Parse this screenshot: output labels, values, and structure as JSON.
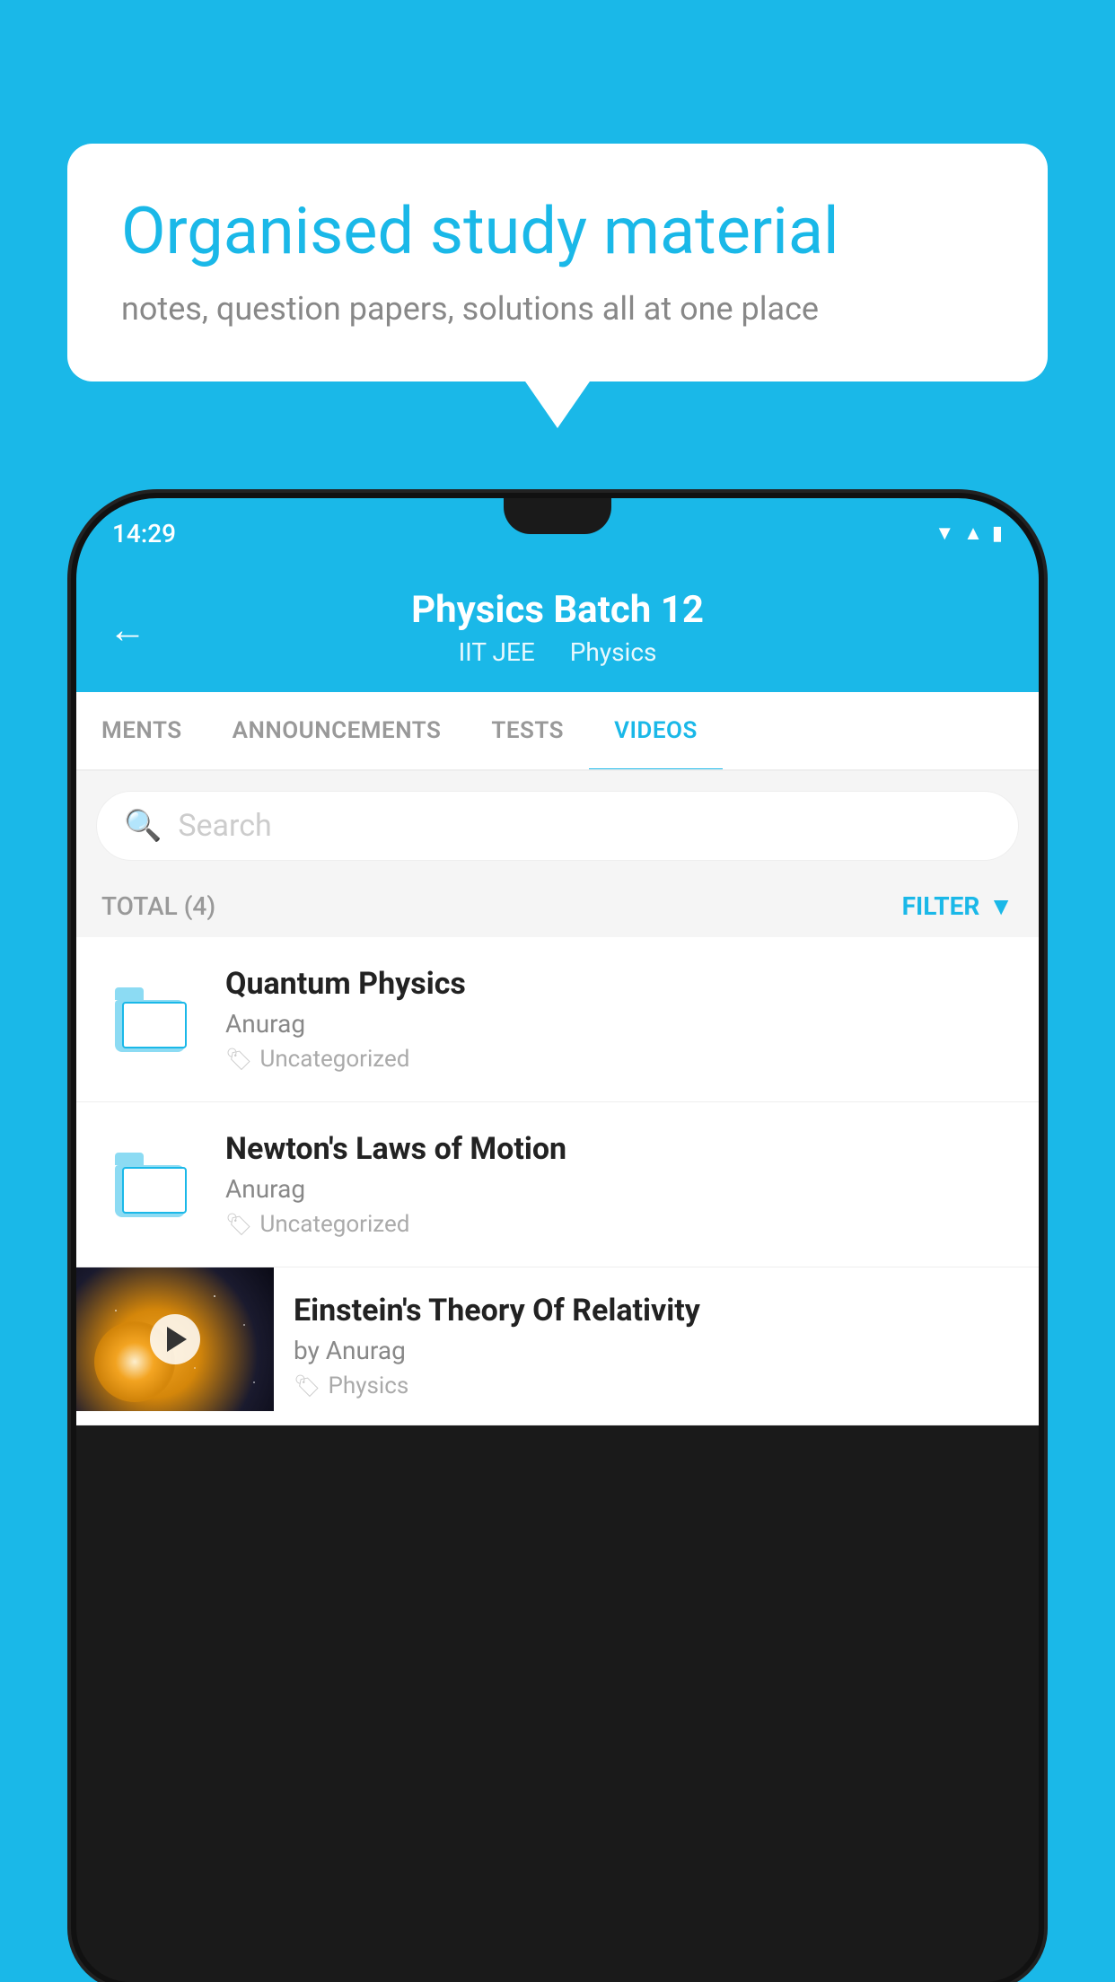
{
  "background_color": "#1ab8e8",
  "bubble": {
    "title": "Organised study material",
    "subtitle": "notes, question papers, solutions all at one place"
  },
  "status_bar": {
    "time": "14:29",
    "signal_icon": "▲",
    "wifi_icon": "▼",
    "battery_icon": "▮"
  },
  "header": {
    "title": "Physics Batch 12",
    "subtitle_part1": "IIT JEE",
    "subtitle_part2": "Physics",
    "back_label": "←"
  },
  "tabs": [
    {
      "label": "MENTS",
      "active": false
    },
    {
      "label": "ANNOUNCEMENTS",
      "active": false
    },
    {
      "label": "TESTS",
      "active": false
    },
    {
      "label": "VIDEOS",
      "active": true
    }
  ],
  "search": {
    "placeholder": "Search"
  },
  "filter": {
    "total_label": "TOTAL (4)",
    "filter_label": "FILTER"
  },
  "video_items": [
    {
      "title": "Quantum Physics",
      "author": "Anurag",
      "tag": "Uncategorized",
      "has_thumb": false
    },
    {
      "title": "Newton's Laws of Motion",
      "author": "Anurag",
      "tag": "Uncategorized",
      "has_thumb": false
    },
    {
      "title": "Einstein's Theory Of Relativity",
      "author": "by Anurag",
      "tag": "Physics",
      "has_thumb": true
    }
  ]
}
